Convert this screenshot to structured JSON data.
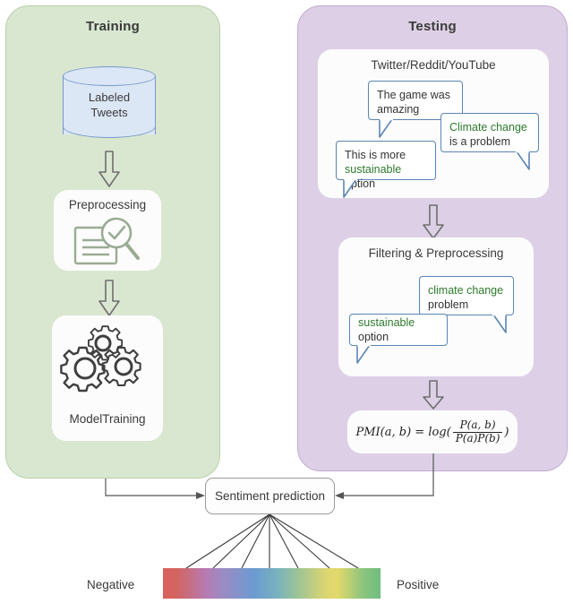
{
  "diagram": {
    "title": "Sentiment analysis pipeline",
    "colors": {
      "training_panel": "#d9e7d1",
      "testing_panel": "#ddd0e6",
      "card": "#fcfcfc",
      "bubble_border": "#5b85b5",
      "highlight_text": "#2d7a2d",
      "cylinder_fill": "#dce7f6",
      "cylinder_border": "#7a98c8",
      "icon_gray": "#4a4a4a",
      "icon_sage": "#9aab94",
      "arrow_gray": "#6e6e6e",
      "connector": "#555555"
    }
  },
  "training": {
    "title": "Training",
    "database": {
      "line1": "Labeled",
      "line2": "Tweets",
      "icon": "database-cylinder-icon"
    },
    "preprocessing": {
      "title": "Preprocessing",
      "icon": "document-magnifier-check-icon"
    },
    "model_training": {
      "title": "ModelTraining",
      "icon": "gears-icon"
    },
    "arrows": [
      "down-block-arrow",
      "down-block-arrow"
    ]
  },
  "testing": {
    "title": "Testing",
    "sources": {
      "title": "Twitter/Reddit/YouTube",
      "bubbles": [
        {
          "name": "bubble-game",
          "segments": [
            {
              "text": "The game was amazing",
              "highlight": false
            }
          ]
        },
        {
          "name": "bubble-climate",
          "segments": [
            {
              "text": "Climate change",
              "highlight": true
            },
            {
              "text": " is a problem",
              "highlight": false
            }
          ]
        },
        {
          "name": "bubble-sustainable",
          "segments": [
            {
              "text": "This is more ",
              "highlight": false
            },
            {
              "text": "sustainable",
              "highlight": true
            },
            {
              "text": " option",
              "highlight": false
            }
          ]
        }
      ]
    },
    "filtering": {
      "title": "Filtering & Preprocessing",
      "bubbles": [
        {
          "name": "bubble-climate-filtered",
          "segments": [
            {
              "text": "climate change",
              "highlight": true
            },
            {
              "text": " problem",
              "highlight": false
            }
          ]
        },
        {
          "name": "bubble-sustainable-filtered",
          "segments": [
            {
              "text": "sustainable",
              "highlight": true
            },
            {
              "text": " option",
              "highlight": false
            }
          ]
        }
      ]
    },
    "pmi": {
      "lhs": "PMI(a, b) = log(",
      "numerator": "P(a, b)",
      "denominator": "P(a)P(b)",
      "rhs": ")"
    },
    "arrows": [
      "down-block-arrow",
      "down-block-arrow"
    ]
  },
  "output": {
    "sentiment_box_label": "Sentiment prediction",
    "scale": {
      "left_label": "Negative",
      "right_label": "Positive",
      "gradient_stops": [
        "#d9615e",
        "#9b8cc4",
        "#6a9bd1",
        "#74b8b0",
        "#e3d96a",
        "#6ebd7e"
      ],
      "fan_line_count": 7
    }
  }
}
